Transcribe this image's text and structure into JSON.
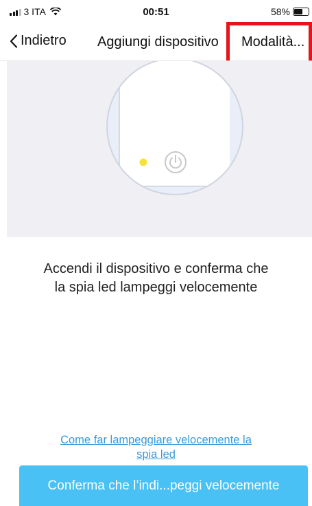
{
  "status_bar": {
    "carrier": "3 ITA",
    "time": "00:51",
    "battery_percent": "58%",
    "battery_level": 0.58,
    "signal_bars_filled": 2,
    "signal_bars_total": 4
  },
  "nav": {
    "back_label": "Indietro",
    "title": "Aggiungi dispositivo",
    "right_label": "Modalità..."
  },
  "instruction": {
    "line1": "Accendi il dispositivo e conferma che",
    "line2": "la spia led lampeggi velocemente"
  },
  "help_link": {
    "line1": "Come far lampeggiare velocemente la",
    "line2": "spia led"
  },
  "confirm_button": {
    "label": "Conferma che l’indi...peggi velocemente"
  },
  "colors": {
    "accent_button": "#49c1f4",
    "link": "#3a9ad9",
    "highlight": "#e8141a",
    "led": "#f4e23a",
    "panel_bg": "#efeff4"
  },
  "icons": [
    "signal-icon",
    "wifi-icon",
    "battery-icon",
    "back-chevron-icon",
    "power-icon",
    "led-indicator-icon"
  ]
}
